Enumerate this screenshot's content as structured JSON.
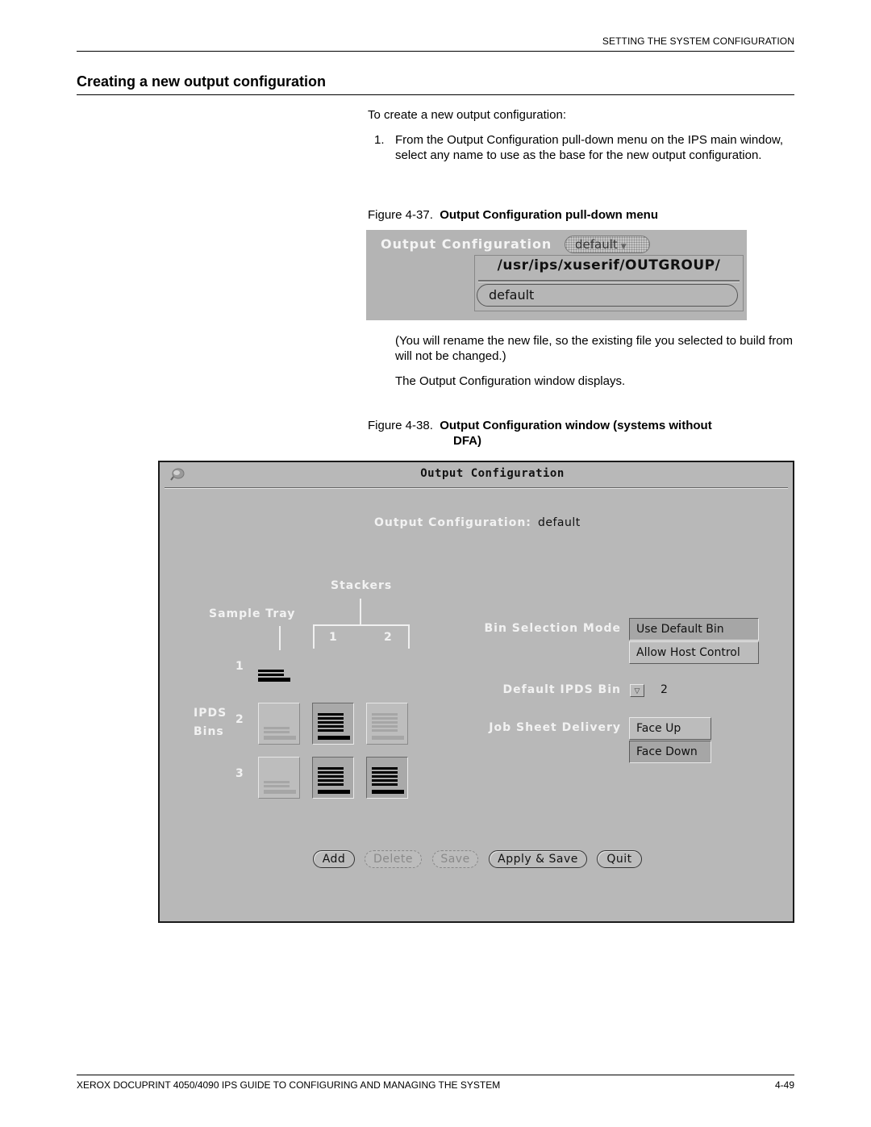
{
  "header": {
    "running_head": "SETTING THE SYSTEM CONFIGURATION",
    "section_title": "Creating a new output configuration"
  },
  "body": {
    "intro": "To create a new output configuration:",
    "steps": [
      {
        "number": "1.",
        "text": "From the Output Configuration pull-down menu on the IPS main window, select any name to use as the base for the new output configuration."
      }
    ],
    "note_rename": "(You will rename the new file, so the existing file you selected to build from will not be changed.)",
    "note_displays": "The Output Configuration window displays."
  },
  "figure37": {
    "number": "Figure 4-37.",
    "caption": "Output Configuration pull-down menu",
    "label": "Output Configuration",
    "pulldown_value": "default",
    "pulldown_icon": "triangle-down-icon",
    "menu_title": "/usr/ips/xuserif/OUTGROUP/",
    "menu_items": [
      "default"
    ]
  },
  "figure38": {
    "number": "Figure 4-38.",
    "caption_line1": "Output Configuration window (systems without",
    "caption_line2": "DFA)",
    "window": {
      "title": "Output Configuration",
      "title_icon": "pushpin-icon",
      "config_label": "Output Configuration:",
      "config_value": "default",
      "stackers_label": "Stackers",
      "sample_tray_label": "Sample Tray",
      "stacker_numbers": [
        "1",
        "2"
      ],
      "row_numbers": [
        "1",
        "2",
        "3"
      ],
      "ipds_bins_label_line1": "IPDS",
      "ipds_bins_label_line2": "Bins",
      "bins": {
        "row2": [
          false,
          true,
          false
        ],
        "row3": [
          false,
          true,
          true
        ]
      },
      "bin_selection_mode": {
        "label": "Bin Selection Mode",
        "options": [
          "Use Default Bin",
          "Allow Host Control"
        ],
        "selected": "Use Default Bin"
      },
      "default_ipds_bin": {
        "label": "Default IPDS Bin",
        "value": "2",
        "icon": "triangle-down-icon"
      },
      "job_sheet_delivery": {
        "label": "Job Sheet Delivery",
        "options": [
          "Face Up",
          "Face Down"
        ],
        "selected": "Face Down"
      },
      "buttons": [
        {
          "label": "Add",
          "enabled": true
        },
        {
          "label": "Delete",
          "enabled": false
        },
        {
          "label": "Save",
          "enabled": false
        },
        {
          "label": "Apply & Save",
          "enabled": true
        },
        {
          "label": "Quit",
          "enabled": true
        }
      ]
    }
  },
  "footer": {
    "title": "XEROX DOCUPRINT 4050/4090 IPS GUIDE TO CONFIGURING AND MANAGING THE SYSTEM",
    "page": "4-49"
  }
}
